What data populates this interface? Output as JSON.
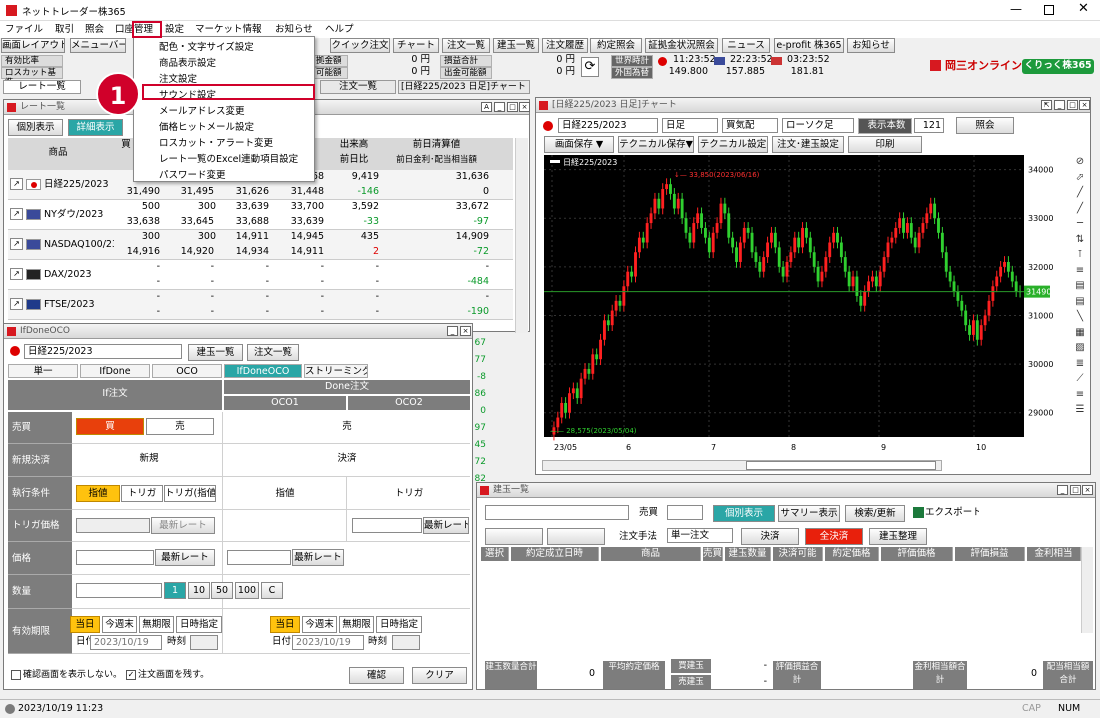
{
  "app": {
    "title": "ネットトレーダー株365"
  },
  "menubar": [
    "ファイル",
    "取引",
    "照会",
    "口座管理",
    "設定",
    "マーケット情報",
    "お知らせ",
    "ヘルプ"
  ],
  "toolbar": {
    "layout": "画面レイアウト▼",
    "menu": "メニューバー▼",
    "buttons": [
      "クイック注文",
      "チャート",
      "注文一覧",
      "建玉一覧",
      "注文履歴",
      "約定照会",
      "証拠金状況照会",
      "ニュース",
      "e-profit 株365",
      "お知らせ"
    ]
  },
  "settings_menu": {
    "items": [
      "配色・文字サイズ設定",
      "商品表示設定",
      "注文設定",
      "サウンド設定",
      "メールアドレス変更",
      "価格ヒットメール設定",
      "ロスカット・アラート変更",
      "レート一覧のExcel連動項目設定",
      "パスワード変更"
    ],
    "highlighted": "サウンド設定",
    "step": "1"
  },
  "account": {
    "labels": [
      "有効比率",
      "ロスカット基準"
    ],
    "l2": [
      "拠金額",
      "可能額"
    ],
    "v2": [
      "0 円",
      "0 円"
    ],
    "l3": [
      "損益合計",
      "出金可能額"
    ],
    "v3": [
      "0 円",
      "0 円"
    ],
    "world_label": "世界時計",
    "fx_label": "外国為替",
    "times": [
      "11:23:52",
      "22:23:52",
      "03:23:52"
    ],
    "fx": [
      "149.800",
      "157.885",
      "181.81"
    ]
  },
  "brand": {
    "name": "岡三オンライン",
    "badge": "くりっく株365"
  },
  "tabs": {
    "rate": "レート一覧",
    "order": "注文一覧",
    "chart": "[日経225/2023 日足]チャート"
  },
  "rate_window": {
    "title": "レート一覧",
    "btn_single": "個別表示",
    "btn_detail": "詳細表示",
    "col_product": "商品",
    "col_buy": "買",
    "col_vol": "出来高",
    "col_prev": "前日清算値",
    "col_prevdiff": "前日比",
    "col_div": "前日金利･配当相当額",
    "rows": [
      {
        "name": "日経225/2023",
        "a": [
          "",
          "",
          "",
          "31,668",
          "9,419",
          "31,636"
        ],
        "b": [
          "31,490",
          "31,495",
          "31,626",
          "31,448",
          "-146",
          "0"
        ]
      },
      {
        "name": "NYダウ/2023",
        "a": [
          "500",
          "",
          "300",
          "33,639",
          "33,700",
          "3,592",
          "33,672"
        ],
        "b": [
          "33,638",
          "33,645",
          "33,688",
          "33,639",
          "-33",
          "-97"
        ]
      },
      {
        "name": "NASDAQ100/23",
        "a": [
          "300",
          "",
          "300",
          "14,911",
          "14,945",
          "435",
          "14,909"
        ],
        "b": [
          "14,916",
          "14,920",
          "14,934",
          "14,911",
          "2",
          "-72"
        ]
      },
      {
        "name": "DAX/2023",
        "a": [
          "-",
          "-",
          "-",
          "-",
          "-",
          "-"
        ],
        "b": [
          "-",
          "-",
          "-",
          "-",
          "-",
          "-484"
        ]
      },
      {
        "name": "FTSE/2023",
        "a": [
          "-",
          "-",
          "-",
          "-",
          "-",
          "-"
        ],
        "b": [
          "-",
          "-",
          "-",
          "-",
          "-",
          "-190"
        ]
      }
    ],
    "extra": [
      "67",
      "77",
      "-8",
      "86",
      "0",
      "97",
      "45",
      "72",
      "82"
    ]
  },
  "ifdone": {
    "title": "IfDoneOCO",
    "product": "日経225/2023",
    "btn_pos": "建玉一覧",
    "btn_orders": "注文一覧",
    "tabs": [
      "単一",
      "IfDone",
      "OCO",
      "IfDoneOCO",
      "ストリーミング"
    ],
    "if_label": "If注文",
    "done_label": "Done注文",
    "oco1": "OCO1",
    "oco2": "OCO2",
    "rows": {
      "side": "売買",
      "type": "新規決済",
      "cond": "執行条件",
      "trig": "トリガ価格",
      "price": "価格",
      "qty": "数量",
      "expiry": "有効期限"
    },
    "buy": "買",
    "sell": "売",
    "sell_label": "売",
    "new_label": "新規",
    "close_label": "決済",
    "cond_btns": [
      "指値",
      "トリガ",
      "トリガ(指値)"
    ],
    "limit": "指値",
    "trigger": "トリガ",
    "latest": "最新レート",
    "qty_btns": [
      "1",
      "10",
      "50",
      "100",
      "C"
    ],
    "exp_btns": [
      "当日",
      "今週末",
      "無期限",
      "日時指定"
    ],
    "date_label": "日付",
    "date": "2023/10/19",
    "time_label": "時刻",
    "chk1": "確認画面を表示しない。",
    "chk2": "注文画面を残す。",
    "confirm": "確認",
    "clear": "クリア"
  },
  "chart_window": {
    "title": "[日経225/2023 日足]チャート",
    "product": "日経225/2023",
    "period": "日足",
    "side": "買気配",
    "style": "ローソク足",
    "count_label": "表示本数",
    "count": "121",
    "inquiry": "照会",
    "btns": [
      "画面保存 ▼",
      "テクニカル保存▼",
      "テクニカル設定",
      "注文･建玉設定",
      "印刷"
    ],
    "legend": "日経225/2023",
    "hi": "33,850(2023/06/16)",
    "lo": "28,575(2023/05/04)",
    "last": "31490",
    "yticks": [
      "34000",
      "33000",
      "32000",
      "31000",
      "30000",
      "29000"
    ],
    "xticks": [
      "23/05",
      "6",
      "7",
      "8",
      "9",
      "10"
    ]
  },
  "positions": {
    "title": "建玉一覧",
    "side_label": "売買",
    "btn_detail": "個別表示",
    "btn_summary": "サマリー表示",
    "btn_search": "検索/更新",
    "btn_export": "エクスポート",
    "btns": [
      "全選択",
      "全解除"
    ],
    "method_label": "注文手法",
    "method": "単一注文",
    "close": "決済",
    "closeall": "全決済",
    "arrange": "建玉整理",
    "cols": [
      "選択",
      "約定成立日時",
      "商品",
      "売買",
      "建玉数量",
      "決済可能",
      "約定価格",
      "評価価格",
      "評価損益",
      "金利相当"
    ],
    "footer": {
      "qty": "建玉数量合計",
      "qty_v": "0",
      "avg": "平均約定価格",
      "buy": "買建玉",
      "sell": "売建玉",
      "dash": "-",
      "pl": "評価損益合計",
      "int": "金利相当額合計",
      "int_v": "0",
      "div": "配当相当額合計"
    }
  },
  "statusbar": {
    "time": "2023/10/19 11:23",
    "cap": "CAP",
    "num": "NUM"
  },
  "chart_data": {
    "type": "candlestick",
    "title": "日経225/2023",
    "y_range": [
      28500,
      34300
    ],
    "x_ticks": [
      "23/05",
      "6",
      "7",
      "8",
      "9",
      "10"
    ],
    "y_ticks": [
      34000,
      33000,
      32000,
      31000,
      30000,
      29000
    ],
    "high": {
      "value": 33850,
      "date": "2023/06/16"
    },
    "low": {
      "value": 28575,
      "date": "2023/05/04"
    },
    "last": 31490,
    "closes": [
      28700,
      28900,
      29200,
      29000,
      29400,
      29500,
      29300,
      29700,
      29900,
      29800,
      30200,
      30100,
      30500,
      30900,
      30800,
      31100,
      31300,
      31200,
      31600,
      31900,
      31800,
      32300,
      32600,
      32500,
      32900,
      33100,
      33400,
      33200,
      33600,
      33700,
      33500,
      33200,
      33400,
      33000,
      32700,
      32500,
      32900,
      33100,
      32800,
      32600,
      32300,
      32700,
      32900,
      33300,
      33100,
      32600,
      32400,
      32100,
      32500,
      32800,
      32700,
      32300,
      32100,
      31900,
      32200,
      32500,
      32700,
      32400,
      32000,
      31800,
      32100,
      32300,
      32600,
      32400,
      32800,
      32600,
      32300,
      32000,
      31700,
      31900,
      32200,
      32500,
      32700,
      32500,
      32200,
      31900,
      31600,
      31800,
      31400,
      31200,
      31500,
      31700,
      31800,
      31600,
      31900,
      32200,
      32500,
      32600,
      32800,
      33000,
      32700,
      32900,
      32600,
      32400,
      32700,
      32900,
      33100,
      33300,
      33000,
      32700,
      32300,
      31900,
      31700,
      31500,
      31300,
      31100,
      30800,
      30600,
      30900,
      30500,
      30800,
      31000,
      31300,
      31600,
      31800,
      32000,
      32100,
      31900,
      31700,
      31500,
      31490
    ]
  }
}
